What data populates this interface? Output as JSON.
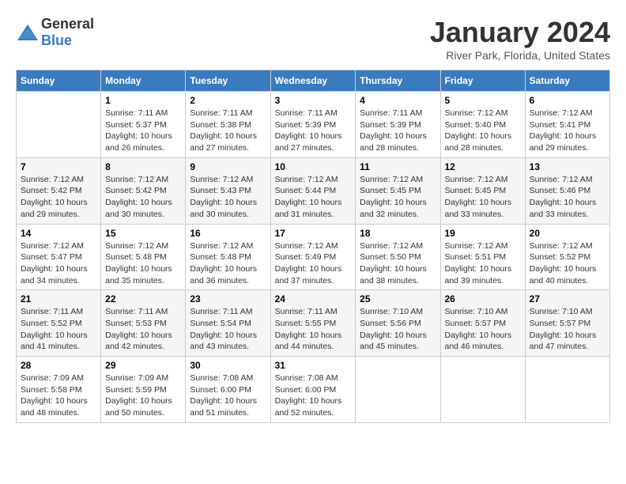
{
  "header": {
    "logo_general": "General",
    "logo_blue": "Blue",
    "title": "January 2024",
    "subtitle": "River Park, Florida, United States"
  },
  "days_of_week": [
    "Sunday",
    "Monday",
    "Tuesday",
    "Wednesday",
    "Thursday",
    "Friday",
    "Saturday"
  ],
  "weeks": [
    [
      {
        "day": "",
        "sunrise": "",
        "sunset": "",
        "daylight": ""
      },
      {
        "day": "1",
        "sunrise": "Sunrise: 7:11 AM",
        "sunset": "Sunset: 5:37 PM",
        "daylight": "Daylight: 10 hours and 26 minutes."
      },
      {
        "day": "2",
        "sunrise": "Sunrise: 7:11 AM",
        "sunset": "Sunset: 5:38 PM",
        "daylight": "Daylight: 10 hours and 27 minutes."
      },
      {
        "day": "3",
        "sunrise": "Sunrise: 7:11 AM",
        "sunset": "Sunset: 5:39 PM",
        "daylight": "Daylight: 10 hours and 27 minutes."
      },
      {
        "day": "4",
        "sunrise": "Sunrise: 7:11 AM",
        "sunset": "Sunset: 5:39 PM",
        "daylight": "Daylight: 10 hours and 28 minutes."
      },
      {
        "day": "5",
        "sunrise": "Sunrise: 7:12 AM",
        "sunset": "Sunset: 5:40 PM",
        "daylight": "Daylight: 10 hours and 28 minutes."
      },
      {
        "day": "6",
        "sunrise": "Sunrise: 7:12 AM",
        "sunset": "Sunset: 5:41 PM",
        "daylight": "Daylight: 10 hours and 29 minutes."
      }
    ],
    [
      {
        "day": "7",
        "sunrise": "Sunrise: 7:12 AM",
        "sunset": "Sunset: 5:42 PM",
        "daylight": "Daylight: 10 hours and 29 minutes."
      },
      {
        "day": "8",
        "sunrise": "Sunrise: 7:12 AM",
        "sunset": "Sunset: 5:42 PM",
        "daylight": "Daylight: 10 hours and 30 minutes."
      },
      {
        "day": "9",
        "sunrise": "Sunrise: 7:12 AM",
        "sunset": "Sunset: 5:43 PM",
        "daylight": "Daylight: 10 hours and 30 minutes."
      },
      {
        "day": "10",
        "sunrise": "Sunrise: 7:12 AM",
        "sunset": "Sunset: 5:44 PM",
        "daylight": "Daylight: 10 hours and 31 minutes."
      },
      {
        "day": "11",
        "sunrise": "Sunrise: 7:12 AM",
        "sunset": "Sunset: 5:45 PM",
        "daylight": "Daylight: 10 hours and 32 minutes."
      },
      {
        "day": "12",
        "sunrise": "Sunrise: 7:12 AM",
        "sunset": "Sunset: 5:45 PM",
        "daylight": "Daylight: 10 hours and 33 minutes."
      },
      {
        "day": "13",
        "sunrise": "Sunrise: 7:12 AM",
        "sunset": "Sunset: 5:46 PM",
        "daylight": "Daylight: 10 hours and 33 minutes."
      }
    ],
    [
      {
        "day": "14",
        "sunrise": "Sunrise: 7:12 AM",
        "sunset": "Sunset: 5:47 PM",
        "daylight": "Daylight: 10 hours and 34 minutes."
      },
      {
        "day": "15",
        "sunrise": "Sunrise: 7:12 AM",
        "sunset": "Sunset: 5:48 PM",
        "daylight": "Daylight: 10 hours and 35 minutes."
      },
      {
        "day": "16",
        "sunrise": "Sunrise: 7:12 AM",
        "sunset": "Sunset: 5:48 PM",
        "daylight": "Daylight: 10 hours and 36 minutes."
      },
      {
        "day": "17",
        "sunrise": "Sunrise: 7:12 AM",
        "sunset": "Sunset: 5:49 PM",
        "daylight": "Daylight: 10 hours and 37 minutes."
      },
      {
        "day": "18",
        "sunrise": "Sunrise: 7:12 AM",
        "sunset": "Sunset: 5:50 PM",
        "daylight": "Daylight: 10 hours and 38 minutes."
      },
      {
        "day": "19",
        "sunrise": "Sunrise: 7:12 AM",
        "sunset": "Sunset: 5:51 PM",
        "daylight": "Daylight: 10 hours and 39 minutes."
      },
      {
        "day": "20",
        "sunrise": "Sunrise: 7:12 AM",
        "sunset": "Sunset: 5:52 PM",
        "daylight": "Daylight: 10 hours and 40 minutes."
      }
    ],
    [
      {
        "day": "21",
        "sunrise": "Sunrise: 7:11 AM",
        "sunset": "Sunset: 5:52 PM",
        "daylight": "Daylight: 10 hours and 41 minutes."
      },
      {
        "day": "22",
        "sunrise": "Sunrise: 7:11 AM",
        "sunset": "Sunset: 5:53 PM",
        "daylight": "Daylight: 10 hours and 42 minutes."
      },
      {
        "day": "23",
        "sunrise": "Sunrise: 7:11 AM",
        "sunset": "Sunset: 5:54 PM",
        "daylight": "Daylight: 10 hours and 43 minutes."
      },
      {
        "day": "24",
        "sunrise": "Sunrise: 7:11 AM",
        "sunset": "Sunset: 5:55 PM",
        "daylight": "Daylight: 10 hours and 44 minutes."
      },
      {
        "day": "25",
        "sunrise": "Sunrise: 7:10 AM",
        "sunset": "Sunset: 5:56 PM",
        "daylight": "Daylight: 10 hours and 45 minutes."
      },
      {
        "day": "26",
        "sunrise": "Sunrise: 7:10 AM",
        "sunset": "Sunset: 5:57 PM",
        "daylight": "Daylight: 10 hours and 46 minutes."
      },
      {
        "day": "27",
        "sunrise": "Sunrise: 7:10 AM",
        "sunset": "Sunset: 5:57 PM",
        "daylight": "Daylight: 10 hours and 47 minutes."
      }
    ],
    [
      {
        "day": "28",
        "sunrise": "Sunrise: 7:09 AM",
        "sunset": "Sunset: 5:58 PM",
        "daylight": "Daylight: 10 hours and 48 minutes."
      },
      {
        "day": "29",
        "sunrise": "Sunrise: 7:09 AM",
        "sunset": "Sunset: 5:59 PM",
        "daylight": "Daylight: 10 hours and 50 minutes."
      },
      {
        "day": "30",
        "sunrise": "Sunrise: 7:08 AM",
        "sunset": "Sunset: 6:00 PM",
        "daylight": "Daylight: 10 hours and 51 minutes."
      },
      {
        "day": "31",
        "sunrise": "Sunrise: 7:08 AM",
        "sunset": "Sunset: 6:00 PM",
        "daylight": "Daylight: 10 hours and 52 minutes."
      },
      {
        "day": "",
        "sunrise": "",
        "sunset": "",
        "daylight": ""
      },
      {
        "day": "",
        "sunrise": "",
        "sunset": "",
        "daylight": ""
      },
      {
        "day": "",
        "sunrise": "",
        "sunset": "",
        "daylight": ""
      }
    ]
  ]
}
